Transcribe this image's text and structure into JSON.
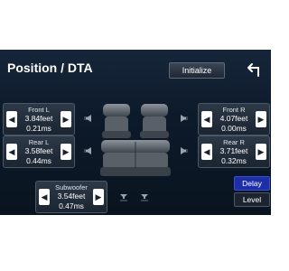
{
  "header": {
    "title": "Position / DTA",
    "initialize_label": "Initialize"
  },
  "panels": {
    "front_l": {
      "name": "Front L",
      "feet": "3.84feet",
      "ms": "0.21ms"
    },
    "front_r": {
      "name": "Front R",
      "feet": "4.07feet",
      "ms": "0.00ms"
    },
    "rear_l": {
      "name": "Rear L",
      "feet": "3.58feet",
      "ms": "0.44ms"
    },
    "rear_r": {
      "name": "Rear R",
      "feet": "3.71feet",
      "ms": "0.32ms"
    },
    "subwoofer": {
      "name": "Subwoofer",
      "feet": "3.54feet",
      "ms": "0.47ms"
    }
  },
  "arrows": {
    "left": "◀",
    "right": "▶"
  },
  "side": {
    "delay_label": "Delay",
    "level_label": "Level"
  },
  "colors": {
    "background": "#0d1a2a",
    "accent_selected": "#1d2fa8",
    "panel": "#2d3947"
  }
}
